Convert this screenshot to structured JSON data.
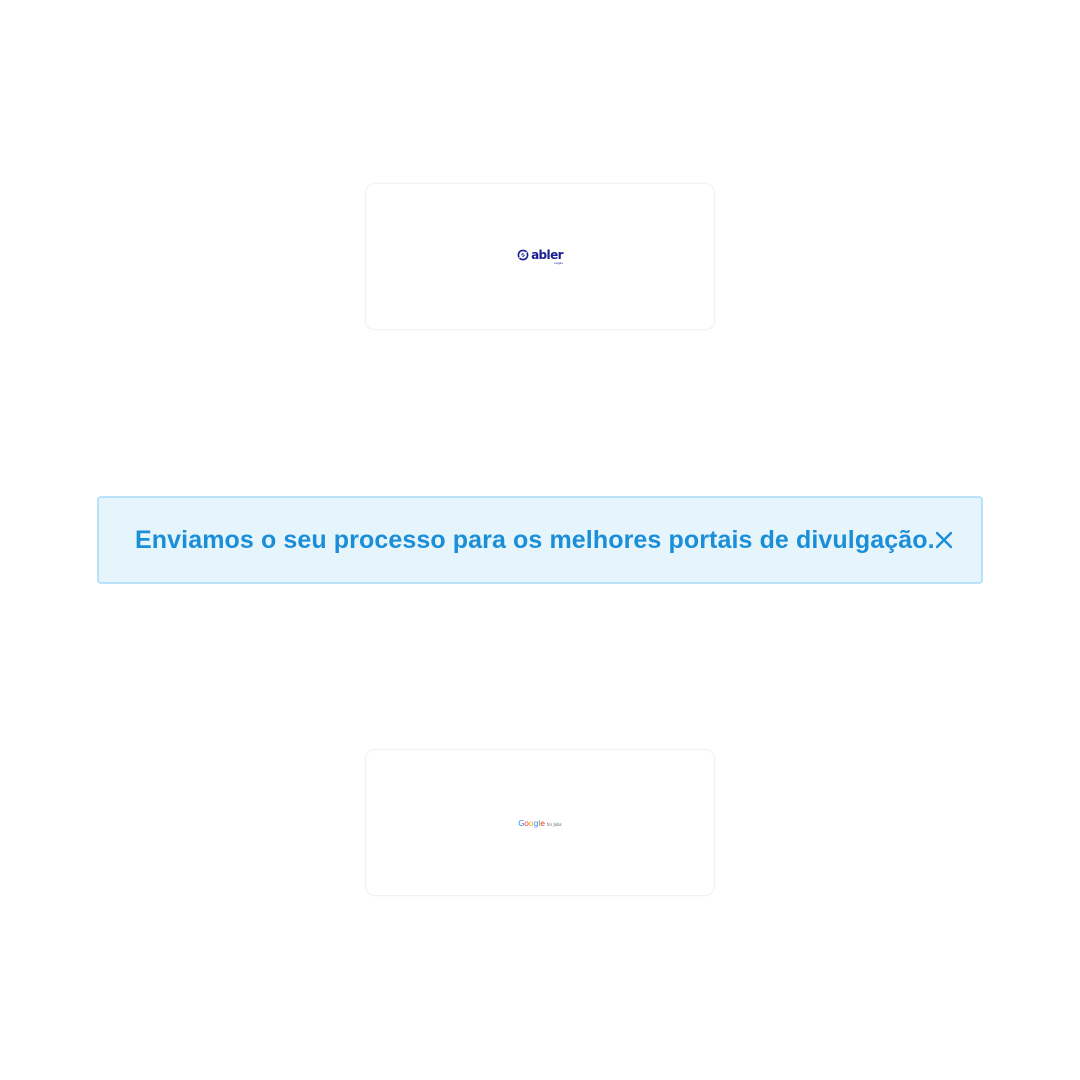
{
  "colors": {
    "banner_background": "#e6f4fc",
    "banner_border": "#b8e0f6",
    "banner_text": "#1a8fd8",
    "abler_brand": "#1a1f8f"
  },
  "portals": [
    {
      "name": "abler",
      "icon": "abler-logo-icon",
      "logo_text": "abler",
      "logo_subtext": "vagas"
    },
    {
      "name": "google",
      "icon": "google-logo-icon",
      "logo_letters": [
        "G",
        "o",
        "o",
        "g",
        "l",
        "e"
      ],
      "logo_subtext": "for Jobs"
    }
  ],
  "banner": {
    "message": "Enviamos o seu processo para os melhores portais de divulgação.",
    "close_icon": "close-icon"
  }
}
